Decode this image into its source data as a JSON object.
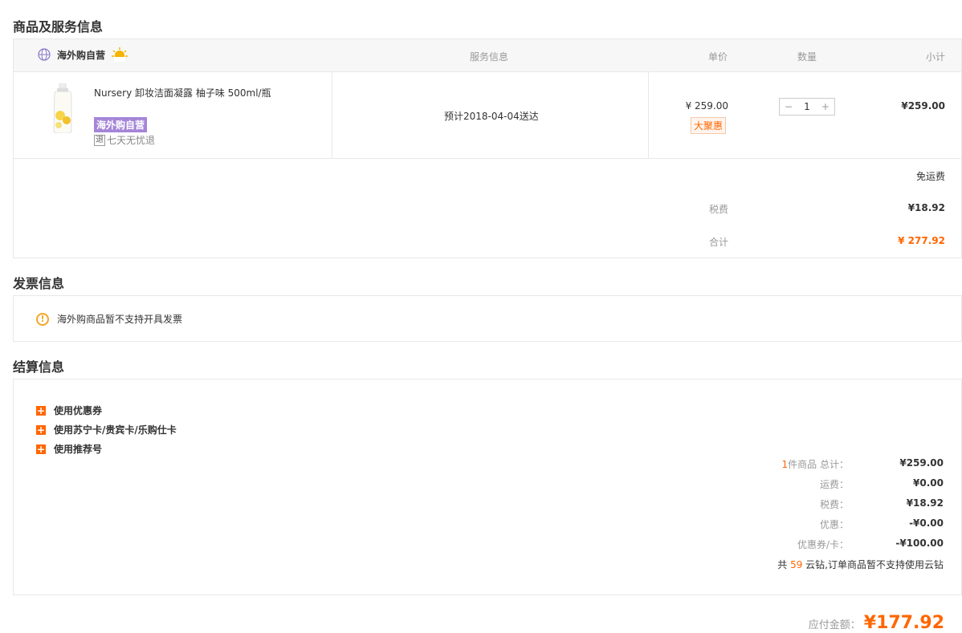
{
  "sections": {
    "products_title": "商品及服务信息",
    "invoice_title": "发票信息",
    "settlement_title": "结算信息"
  },
  "table_header": {
    "store": "海外购自营",
    "service": "服务信息",
    "unit_price": "单价",
    "quantity": "数量",
    "subtotal": "小计"
  },
  "product": {
    "name": "Nursery 卸妆洁面凝露 柚子味 500ml/瓶",
    "tag": "海外购自营",
    "return_icon": "退",
    "return_policy": "七天无忧退",
    "delivery": "预计2018-04-04送达",
    "price": "¥ 259.00",
    "promo_badge": "大聚惠",
    "quantity": "1",
    "minus": "−",
    "plus": "+",
    "subtotal": "¥259.00"
  },
  "fees": {
    "shipping": "免运费",
    "tax_label": "税费",
    "tax_value": "¥18.92",
    "total_label": "合计",
    "total_value": "¥ 277.92"
  },
  "invoice": {
    "notice": "海外购商品暂不支持开具发票"
  },
  "settlement": {
    "options": [
      "使用优惠券",
      "使用苏宁卡/贵宾卡/乐购仕卡",
      "使用推荐号"
    ],
    "item_count": "1",
    "item_label": "件商品 总计：",
    "item_total": "¥259.00",
    "shipping_label": "运费：",
    "shipping_value": "¥0.00",
    "tax_label": "税费：",
    "tax_value": "¥18.92",
    "discount_label": "优惠：",
    "discount_value": "-¥0.00",
    "coupon_label": "优惠券/卡：",
    "coupon_value": "-¥100.00",
    "coin_prefix": "共",
    "coin_count": "59",
    "coin_suffix": "云钻,订单商品暂不支持使用云钻"
  },
  "payable": {
    "label": "应付金额：",
    "value": "¥177.92"
  },
  "colors": {
    "accent": "#ff6600",
    "tag_purple": "#a585d8",
    "warn": "#f5a623"
  }
}
